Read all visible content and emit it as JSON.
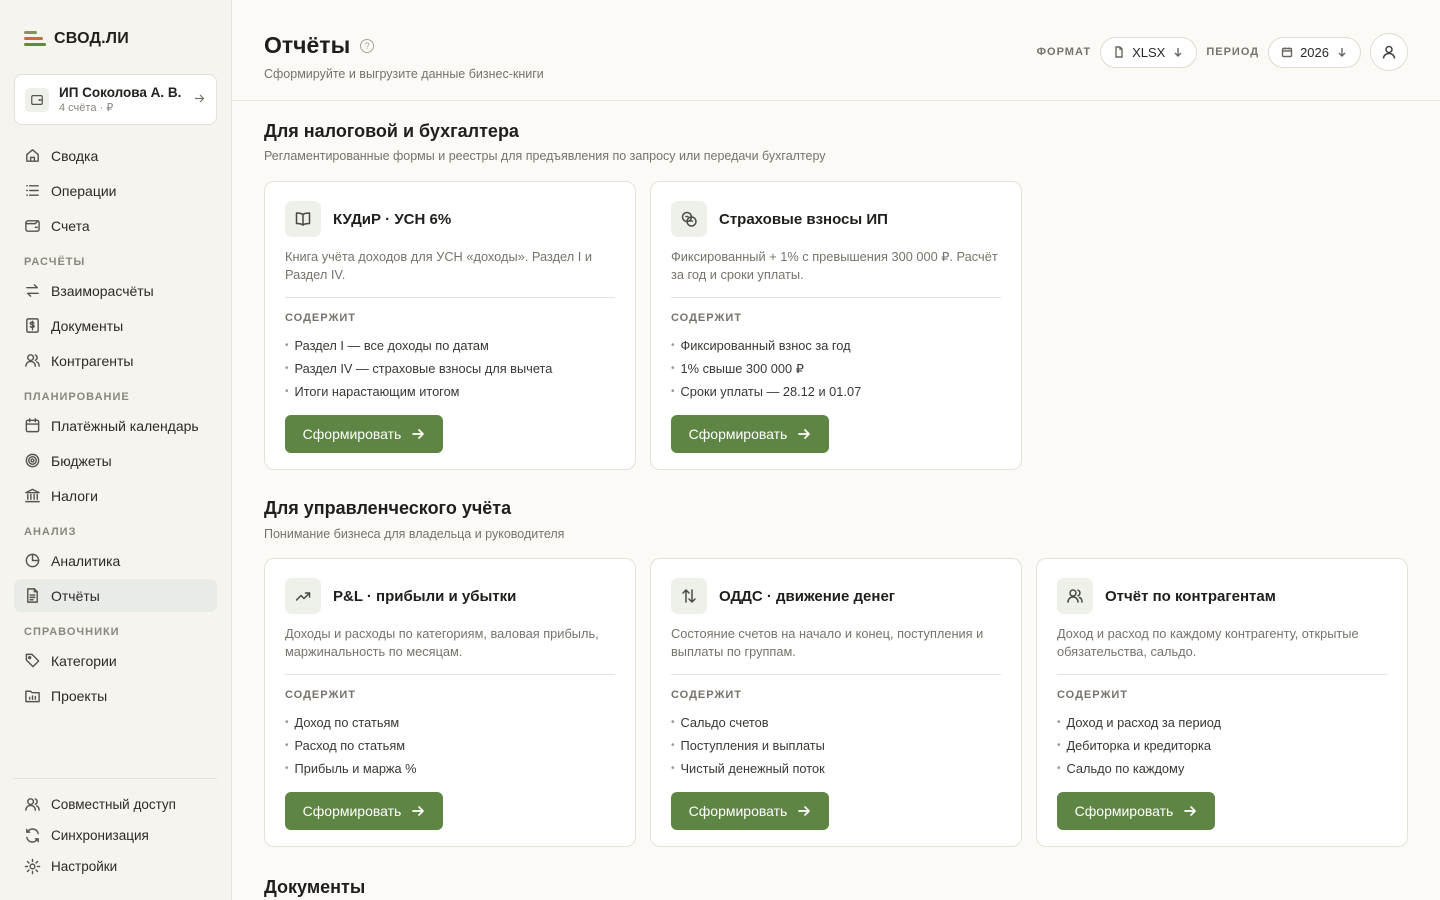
{
  "brand": {
    "name": "СВОД.ЛИ"
  },
  "account": {
    "name": "ИП Соколова А. В.",
    "sub": "4 счёта · ₽"
  },
  "nav": {
    "main": [
      "Сводка",
      "Операции",
      "Счета"
    ],
    "sections": [
      {
        "title": "РАСЧЁТЫ",
        "items": [
          "Взаиморасчёты",
          "Документы",
          "Контрагенты"
        ]
      },
      {
        "title": "ПЛАНИРОВАНИЕ",
        "items": [
          "Платёжный календарь",
          "Бюджеты",
          "Налоги"
        ]
      },
      {
        "title": "АНАЛИЗ",
        "items": [
          "Аналитика",
          "Отчёты"
        ]
      },
      {
        "title": "СПРАВОЧНИКИ",
        "items": [
          "Категории",
          "Проекты"
        ]
      }
    ],
    "bottom": [
      "Совместный доступ",
      "Синхронизация",
      "Настройки"
    ]
  },
  "header": {
    "title": "Отчёты",
    "help": "?",
    "subtitle": "Сформируйте и выгрузите данные бизнес-книги",
    "format_label": "ФОРМАТ",
    "format_value": "XLSX",
    "period_label": "ПЕРИОД",
    "period_value": "2026"
  },
  "sections": [
    {
      "title": "Для налоговой и бухгалтера",
      "subtitle": "Регламентированные формы и реестры для предъявления по запросу или передачи бухгалтеру",
      "cards": [
        {
          "icon": "book-icon",
          "title": "КУДиР · УСН 6%",
          "desc": "Книга учёта доходов для УСН «доходы». Раздел I и Раздел IV.",
          "contains": "СОДЕРЖИТ",
          "items": [
            "Раздел I — все доходы по датам",
            "Раздел IV — страховые взносы для вычета",
            "Итоги нарастающим итогом"
          ],
          "button": "Сформировать"
        },
        {
          "icon": "coins-icon",
          "title": "Страховые взносы ИП",
          "desc": "Фиксированный + 1% с превышения 300 000 ₽. Расчёт за год и сроки уплаты.",
          "contains": "СОДЕРЖИТ",
          "items": [
            "Фиксированный взнос за год",
            "1% свыше 300 000 ₽",
            "Сроки уплаты — 28.12 и 01.07"
          ],
          "button": "Сформировать"
        }
      ]
    },
    {
      "title": "Для управленческого учёта",
      "subtitle": "Понимание бизнеса для владельца и руководителя",
      "cards": [
        {
          "icon": "trending-up-icon",
          "title": "P&L · прибыли и убытки",
          "desc": "Доходы и расходы по категориям, валовая прибыль, маржинальность по месяцам.",
          "contains": "СОДЕРЖИТ",
          "items": [
            "Доход по статьям",
            "Расход по статьям",
            "Прибыль и маржа %"
          ],
          "button": "Сформировать"
        },
        {
          "icon": "arrows-up-down-icon",
          "title": "ОДДС · движение денег",
          "desc": "Состояние счетов на начало и конец, поступления и выплаты по группам.",
          "contains": "СОДЕРЖИТ",
          "items": [
            "Сальдо счетов",
            "Поступления и выплаты",
            "Чистый денежный поток"
          ],
          "button": "Сформировать"
        },
        {
          "icon": "users-icon",
          "title": "Отчёт по контрагентам",
          "desc": "Доход и расход по каждому контрагенту, открытые обязательства, сальдо.",
          "contains": "СОДЕРЖИТ",
          "items": [
            "Доход и расход за период",
            "Дебиторка и кредиторка",
            "Сальдо по каждому"
          ],
          "button": "Сформировать"
        }
      ]
    },
    {
      "title": "Документы"
    }
  ],
  "colors": {
    "accent": "#5e8544",
    "sidebar_bg": "#f6f4ef",
    "page_bg": "#fbfaf7"
  }
}
